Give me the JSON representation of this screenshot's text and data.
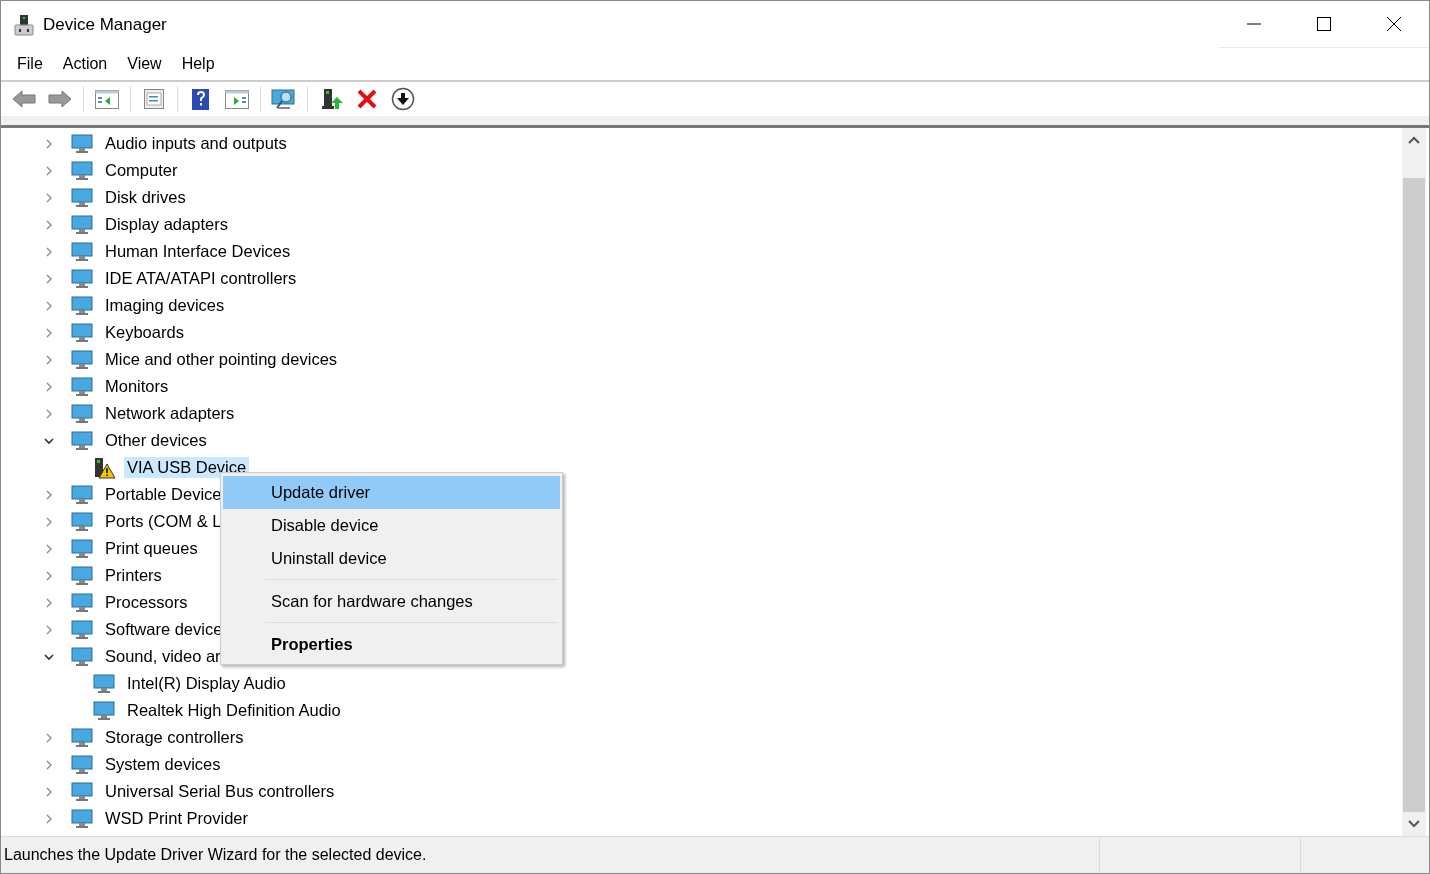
{
  "window": {
    "title": "Device Manager"
  },
  "menu_bar": [
    "File",
    "Action",
    "View",
    "Help"
  ],
  "tree": [
    {
      "label": "Audio inputs and outputs",
      "expanded": false,
      "selected": false
    },
    {
      "label": "Computer",
      "expanded": false,
      "selected": false
    },
    {
      "label": "Disk drives",
      "expanded": false,
      "selected": false
    },
    {
      "label": "Display adapters",
      "expanded": false,
      "selected": false
    },
    {
      "label": "Human Interface Devices",
      "expanded": false,
      "selected": false
    },
    {
      "label": "IDE ATA/ATAPI controllers",
      "expanded": false,
      "selected": false
    },
    {
      "label": "Imaging devices",
      "expanded": false,
      "selected": false
    },
    {
      "label": "Keyboards",
      "expanded": false,
      "selected": false
    },
    {
      "label": "Mice and other pointing devices",
      "expanded": false,
      "selected": false
    },
    {
      "label": "Monitors",
      "expanded": false,
      "selected": false
    },
    {
      "label": "Network adapters",
      "expanded": false,
      "selected": false
    },
    {
      "label": "Other devices",
      "expanded": true,
      "selected": false,
      "children": [
        {
          "label": "VIA USB Device",
          "selected": true,
          "warning": true
        }
      ]
    },
    {
      "label": "Portable Device",
      "expanded": false,
      "selected": false
    },
    {
      "label": "Ports (COM & L",
      "expanded": false,
      "selected": false
    },
    {
      "label": "Print queues",
      "expanded": false,
      "selected": false
    },
    {
      "label": "Printers",
      "expanded": false,
      "selected": false
    },
    {
      "label": "Processors",
      "expanded": false,
      "selected": false
    },
    {
      "label": "Software device",
      "expanded": false,
      "selected": false
    },
    {
      "label": "Sound, video ar",
      "expanded": true,
      "selected": false,
      "children": [
        {
          "label": "Intel(R) Display Audio",
          "selected": false,
          "warning": false
        },
        {
          "label": "Realtek High Definition Audio",
          "selected": false,
          "warning": false
        }
      ]
    },
    {
      "label": "Storage controllers",
      "expanded": false,
      "selected": false
    },
    {
      "label": "System devices",
      "expanded": false,
      "selected": false
    },
    {
      "label": "Universal Serial Bus controllers",
      "expanded": false,
      "selected": false
    },
    {
      "label": "WSD Print Provider",
      "expanded": false,
      "selected": false
    }
  ],
  "context_menu": [
    {
      "label": "Update driver",
      "selected": true,
      "default": false,
      "separator_before": false
    },
    {
      "label": "Disable device",
      "selected": false,
      "default": false,
      "separator_before": false
    },
    {
      "label": "Uninstall device",
      "selected": false,
      "default": false,
      "separator_before": false
    },
    {
      "label": "Scan for hardware changes",
      "selected": false,
      "default": false,
      "separator_before": true
    },
    {
      "label": "Properties",
      "selected": false,
      "default": true,
      "separator_before": true
    }
  ],
  "status_bar": {
    "text": "Launches the Update Driver Wizard for the selected device."
  }
}
